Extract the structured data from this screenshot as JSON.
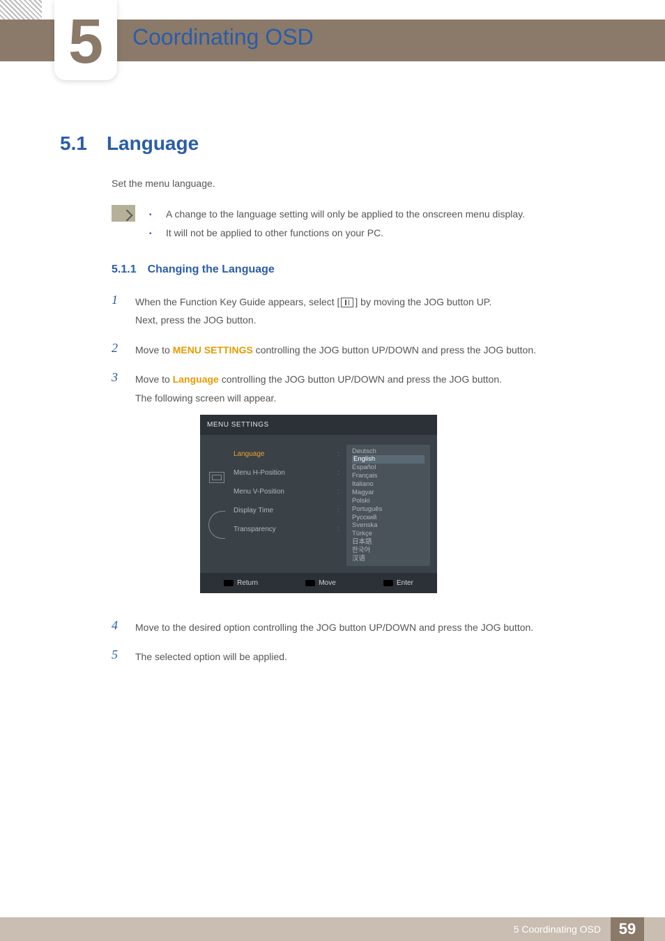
{
  "chapter": {
    "number": "5",
    "title": "Coordinating OSD"
  },
  "section": {
    "number": "5.1",
    "title": "Language"
  },
  "intro": "Set the menu language.",
  "notes": [
    "A change to the language setting will only be applied to the onscreen menu display.",
    "It will not be applied to other functions on your PC."
  ],
  "subsection": {
    "number": "5.1.1",
    "title": "Changing the Language"
  },
  "steps": {
    "s1a": "When the Function Key Guide appears, select  [",
    "s1b": "]  by moving the JOG button UP.",
    "s1c": "Next, press the JOG button.",
    "s2a": "Move to ",
    "s2hl": "MENU SETTINGS",
    "s2b": " controlling the JOG button UP/DOWN and press the JOG button.",
    "s3a": "Move to ",
    "s3hl": "Language",
    "s3b": " controlling the JOG button UP/DOWN and press the JOG button.",
    "s3c": "The following screen will appear.",
    "s4": "Move to the desired option controlling the JOG button UP/DOWN and press the JOG button.",
    "s5": "The selected option will be applied."
  },
  "osd": {
    "title": "MENU SETTINGS",
    "menu": [
      "Language",
      "Menu H-Position",
      "Menu V-Position",
      "Display Time",
      "Transparency"
    ],
    "languages": [
      "Deutsch",
      "English",
      "Español",
      "Français",
      "Italiano",
      "Magyar",
      "Polski",
      "Português",
      "Русский",
      "Svenska",
      "Türkçe",
      "日本語",
      "한국어",
      "汉语"
    ],
    "selected_language": "English",
    "footer": {
      "return": "Return",
      "move": "Move",
      "enter": "Enter"
    }
  },
  "footer": {
    "text": "5 Coordinating OSD",
    "page": "59"
  }
}
